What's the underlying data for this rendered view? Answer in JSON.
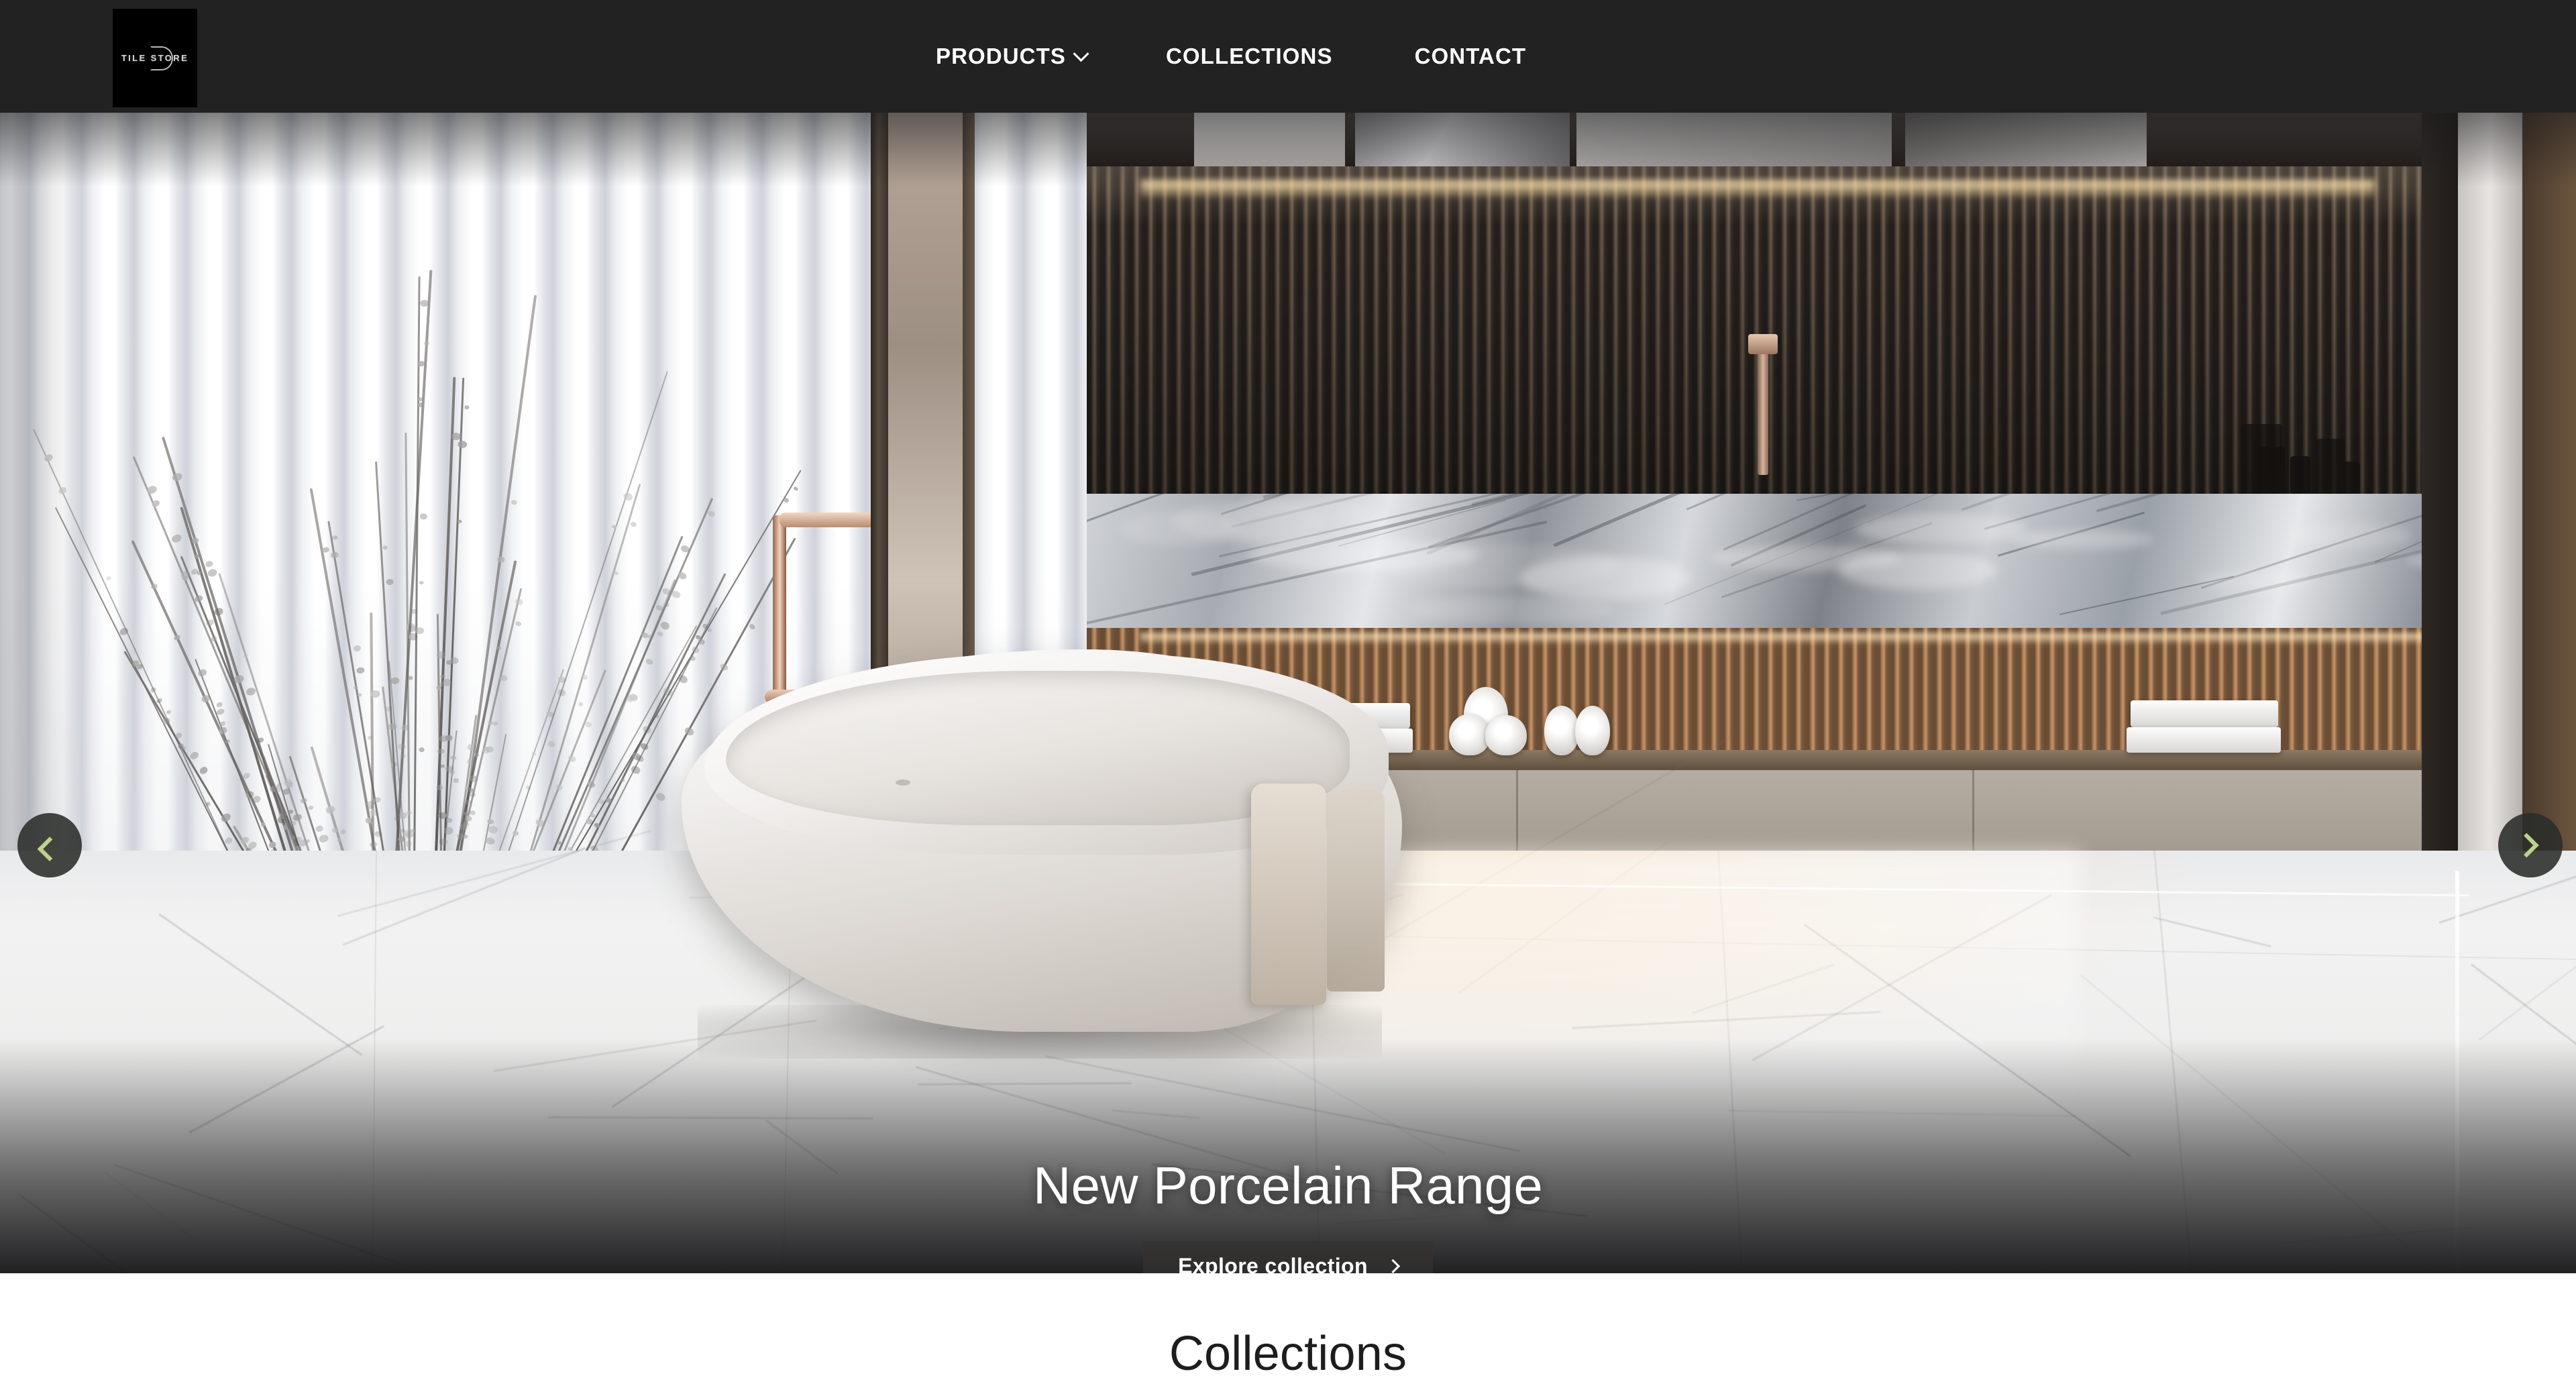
{
  "site": {
    "logo": {
      "wordmark": "TILE STORE",
      "icon": "circle-arc-logo-mark"
    }
  },
  "header": {
    "nav": [
      {
        "label": "PRODUCTS",
        "has_dropdown": true,
        "icon": "chevron-down-icon"
      },
      {
        "label": "COLLECTIONS",
        "has_dropdown": false
      },
      {
        "label": "CONTACT",
        "has_dropdown": false
      }
    ]
  },
  "hero": {
    "title": "New Porcelain Range",
    "cta_label": "Explore collection",
    "cta_icon": "chevron-right-icon",
    "prev_icon": "chevron-left-icon",
    "next_icon": "chevron-right-icon",
    "slides": [
      {
        "index": 1,
        "active": false
      },
      {
        "index": 2,
        "active": true
      },
      {
        "index": 3,
        "active": false
      }
    ],
    "active_slide": 2,
    "image_alt": "Luxury bathroom with freestanding oval bathtub, sheer curtains, dried willow branches in glass vase, rose-gold floor faucet, fluted wood wall with LED lighting, grey marble backsplash and white marble tile floor"
  },
  "collections": {
    "heading": "Collections"
  },
  "colors": {
    "header_bg": "#222223",
    "logo_bg": "#000000",
    "accent_green": "#a2c86a",
    "arrow_chevron": "#bcd28e",
    "arrow_bg": "rgba(42,44,42,0.88)",
    "cta_bg": "rgba(52,50,48,0.72)",
    "text_light": "#ffffff",
    "text_dark": "#1d1d1f",
    "page_bg": "#ffffff"
  }
}
